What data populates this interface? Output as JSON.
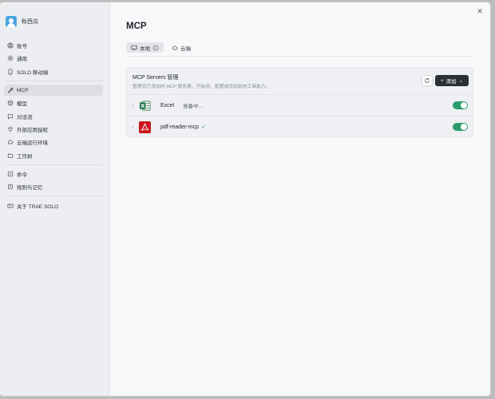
{
  "user": {
    "name": "秋西瓜"
  },
  "sidebar": {
    "items": [
      {
        "label": "账号",
        "icon": "user-circle-icon"
      },
      {
        "label": "通用",
        "icon": "gear-icon"
      },
      {
        "label": "SOLO 移动端",
        "icon": "mobile-icon"
      },
      {
        "label": "MCP",
        "icon": "wrench-icon",
        "active": true
      },
      {
        "label": "模型",
        "icon": "cube-icon"
      },
      {
        "label": "对话流",
        "icon": "chat-icon"
      },
      {
        "label": "外部应用授权",
        "icon": "plug-icon"
      },
      {
        "label": "云端运行环境",
        "icon": "cloud-icon"
      },
      {
        "label": "工作树",
        "icon": "folder-tree-icon"
      },
      {
        "label": "命令",
        "icon": "command-icon"
      },
      {
        "label": "规则与记忆",
        "icon": "book-icon"
      },
      {
        "label": "关于 TRAE SOLO",
        "icon": "info-card-icon"
      }
    ]
  },
  "main": {
    "title": "MCP",
    "tabs": [
      {
        "label": "本地",
        "icon": "monitor-icon",
        "active": true
      },
      {
        "label": "云端",
        "icon": "cloud-icon",
        "active": false
      }
    ],
    "card": {
      "title": "MCP Servers 管理",
      "description": "管理您已添加的 MCP 服务器，可启用、配置或添加新的工具能力。",
      "add_label": "添加"
    },
    "servers": [
      {
        "name": "Excel",
        "status": "准备中...",
        "enabled": true
      },
      {
        "name": "pdf-reader-mcp",
        "status": "✓",
        "enabled": true
      }
    ]
  },
  "colors": {
    "accent_green": "#2a9b6a",
    "dark_button": "#2b2f36",
    "excel_green": "#1d7044",
    "pdf_red": "#c8161d"
  }
}
